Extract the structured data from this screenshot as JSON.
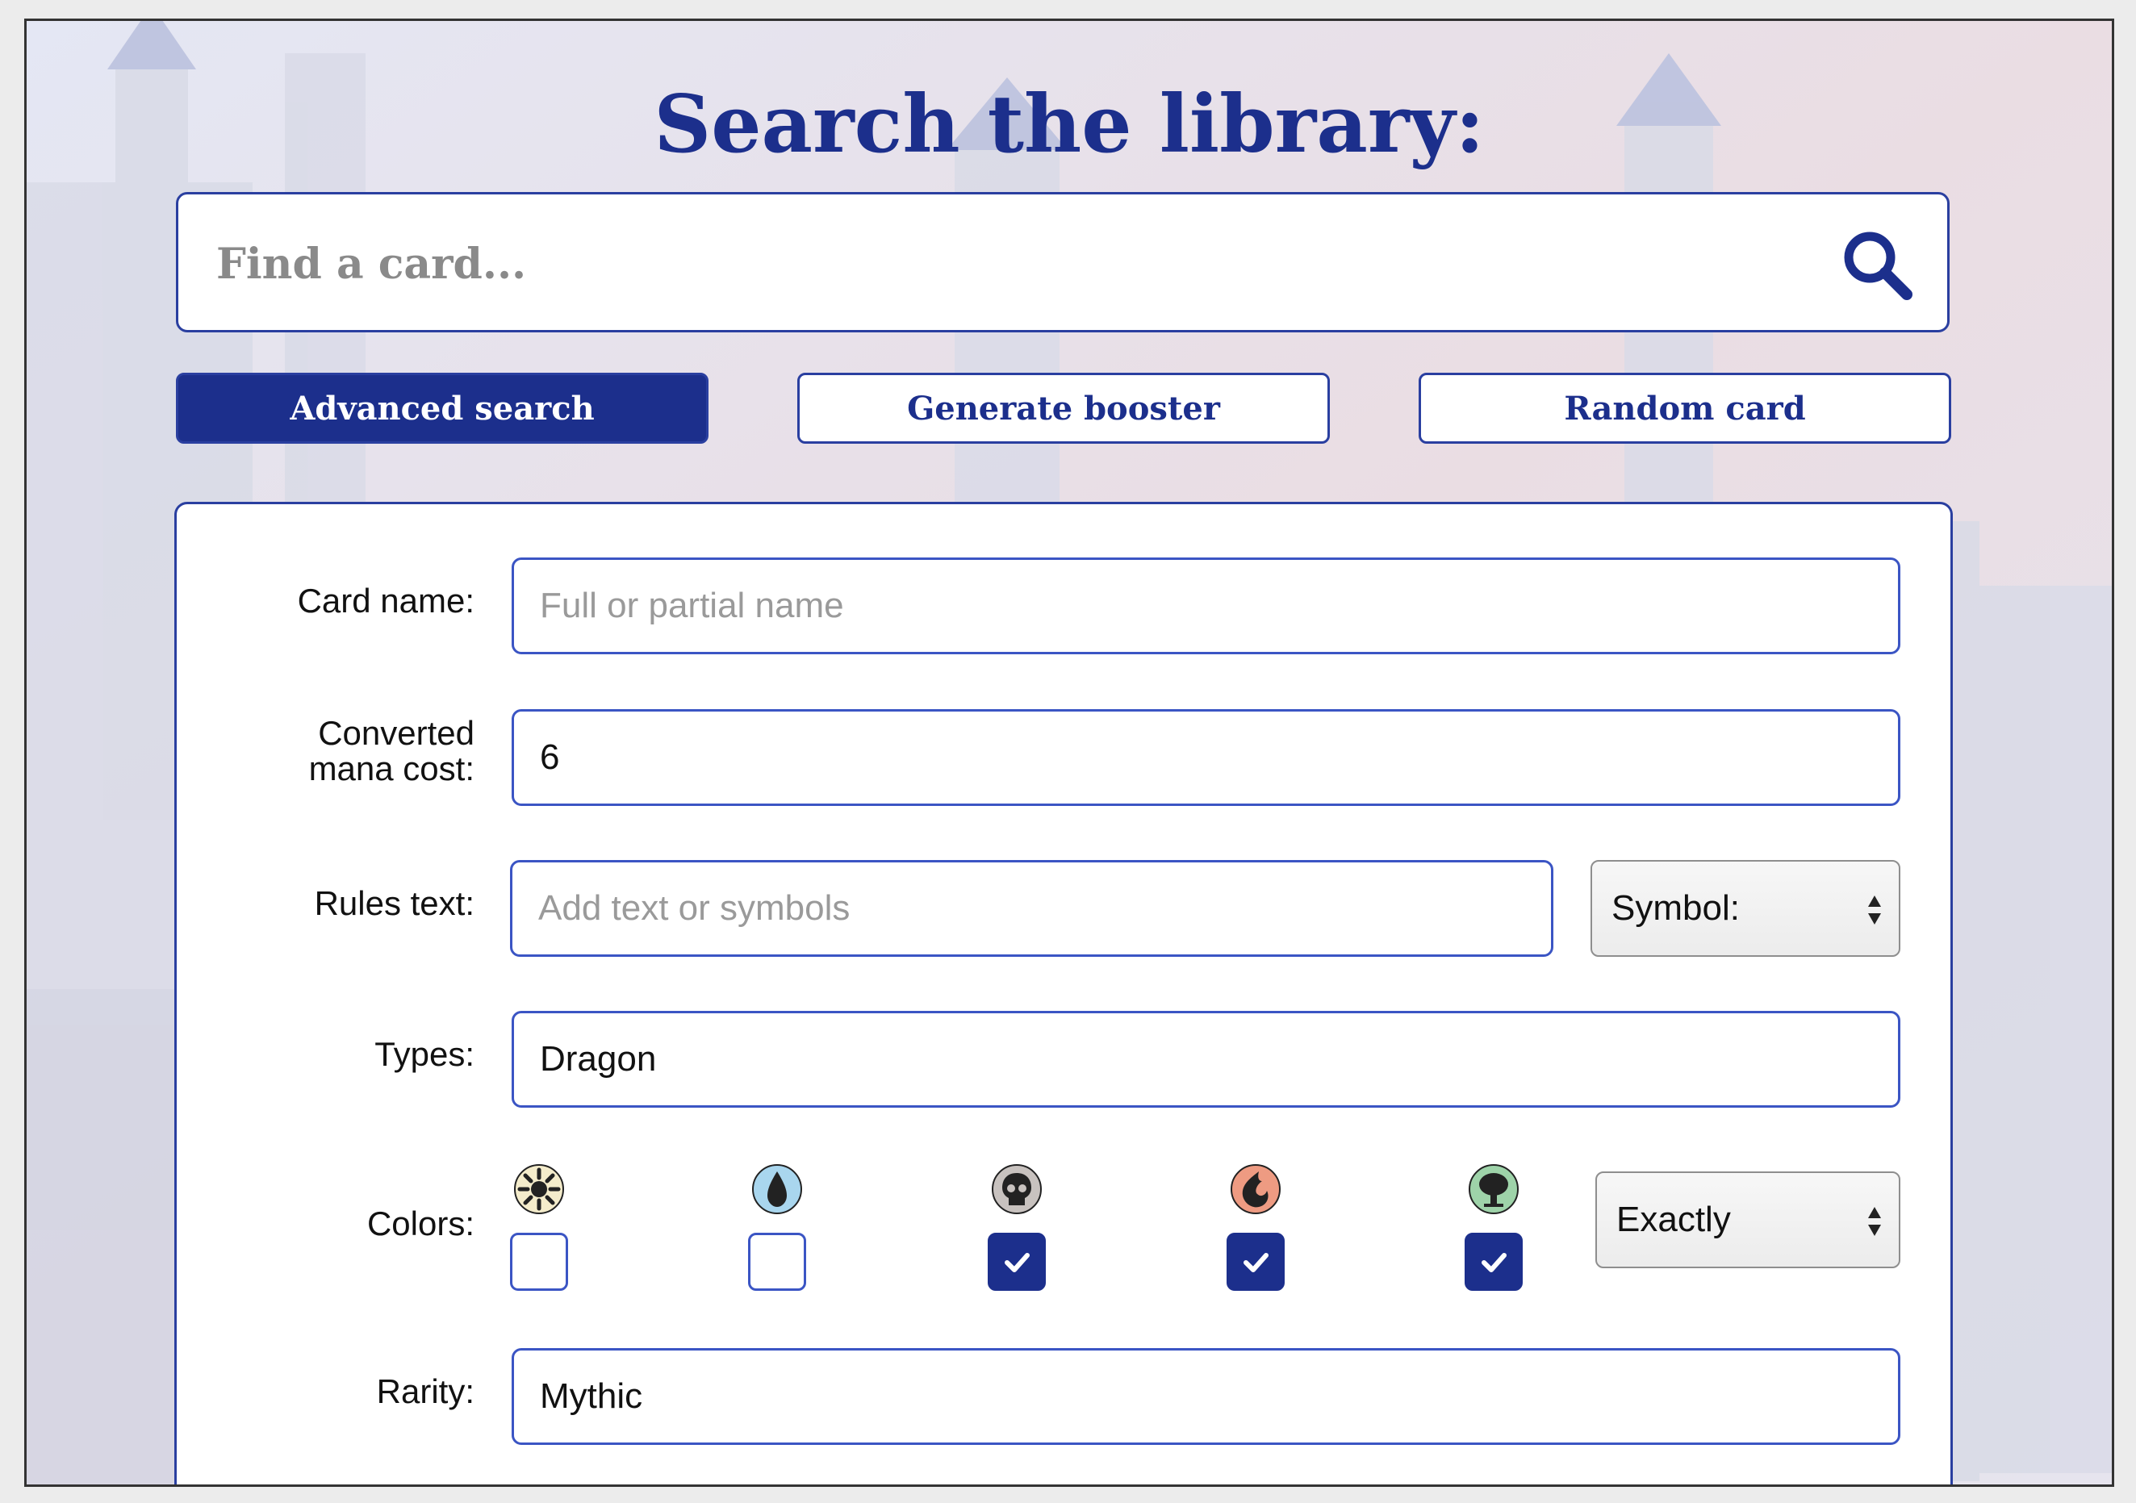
{
  "header": {
    "title": "Search the library:"
  },
  "search": {
    "placeholder": "Find a card...",
    "value": ""
  },
  "tabs": [
    {
      "label": "Advanced search",
      "active": true
    },
    {
      "label": "Generate booster",
      "active": false
    },
    {
      "label": "Random card",
      "active": false
    }
  ],
  "form": {
    "card_name": {
      "label": "Card name:",
      "placeholder": "Full or partial name",
      "value": ""
    },
    "cmc": {
      "label_line1": "Converted",
      "label_line2": "mana cost:",
      "value": "6"
    },
    "rules_text": {
      "label": "Rules text:",
      "placeholder": "Add text or symbols",
      "value": "",
      "symbol_select": "Symbol:"
    },
    "types": {
      "label": "Types:",
      "value": "Dragon"
    },
    "colors": {
      "label": "Colors:",
      "options": [
        {
          "name": "white",
          "icon": "white-mana-icon",
          "checked": false
        },
        {
          "name": "blue",
          "icon": "blue-mana-icon",
          "checked": false
        },
        {
          "name": "black",
          "icon": "black-mana-icon",
          "checked": true
        },
        {
          "name": "red",
          "icon": "red-mana-icon",
          "checked": true
        },
        {
          "name": "green",
          "icon": "green-mana-icon",
          "checked": true
        }
      ],
      "match_mode": "Exactly"
    },
    "rarity": {
      "label": "Rarity:",
      "value": "Mythic"
    }
  },
  "colors": {
    "brand": "#1c2f8c",
    "field_border": "#3b55c4",
    "checked": "#1c2f8c"
  }
}
